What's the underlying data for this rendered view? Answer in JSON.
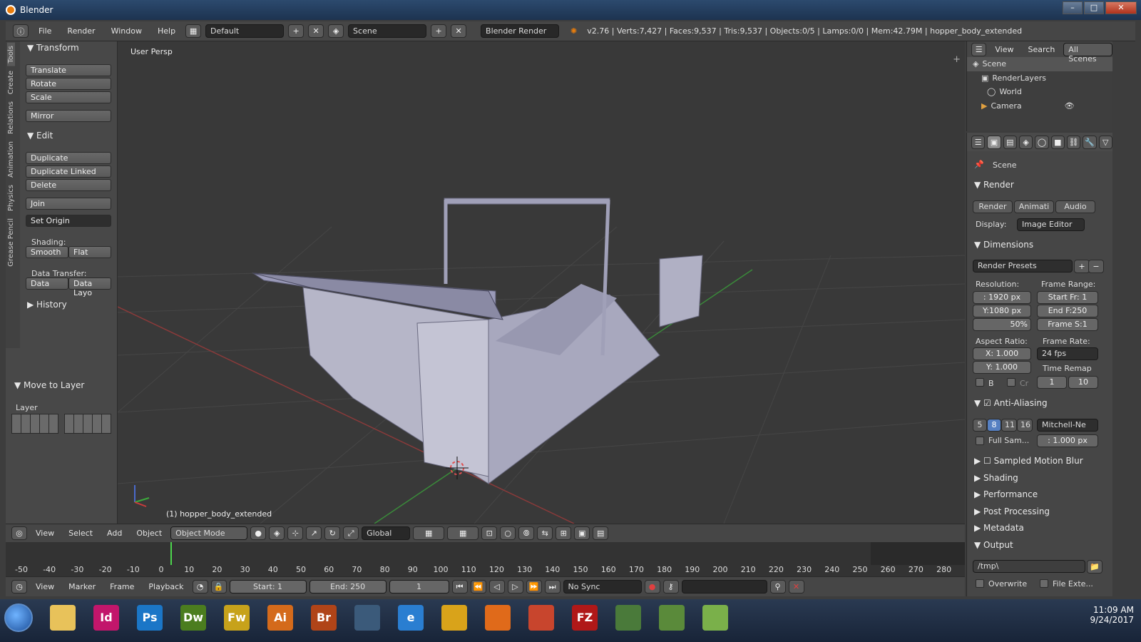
{
  "window": {
    "title": "Blender",
    "min": "–",
    "max": "□",
    "close": "✕"
  },
  "infobar": {
    "menus": [
      "File",
      "Render",
      "Window",
      "Help"
    ],
    "layout": "Default",
    "scene": "Scene",
    "engine": "Blender Render",
    "stats": "v2.76 | Verts:7,427 | Faces:9,537 | Tris:9,537 | Objects:0/5 | Lamps:0/0 | Mem:42.79M | hopper_body_extended"
  },
  "toolshelf": {
    "tabs": [
      "Tools",
      "Create",
      "Relations",
      "Animation",
      "Physics",
      "Grease Pencil"
    ],
    "transform_header": "Transform",
    "translate": "Translate",
    "rotate": "Rotate",
    "scale": "Scale",
    "mirror": "Mirror",
    "edit_header": "Edit",
    "duplicate": "Duplicate",
    "duplicate_linked": "Duplicate Linked",
    "delete": "Delete",
    "join": "Join",
    "set_origin": "Set Origin",
    "shading_label": "Shading:",
    "smooth": "Smooth",
    "flat": "Flat",
    "data_transfer_label": "Data Transfer:",
    "data": "Data",
    "data_layout": "Data Layo",
    "history_header": "History",
    "move_to_layer_header": "Move to Layer",
    "layer_label": "Layer"
  },
  "viewport": {
    "view_label": "User Persp",
    "object_label": "(1) hopper_body_extended"
  },
  "vp_header": {
    "menus": [
      "View",
      "Select",
      "Add",
      "Object"
    ],
    "mode": "Object Mode",
    "orientation": "Global"
  },
  "timeline": {
    "ticks": [
      "-50",
      "-40",
      "-30",
      "-20",
      "-10",
      "0",
      "10",
      "20",
      "30",
      "40",
      "50",
      "60",
      "70",
      "80",
      "90",
      "100",
      "110",
      "120",
      "130",
      "140",
      "150",
      "160",
      "170",
      "180",
      "190",
      "200",
      "210",
      "220",
      "230",
      "240",
      "250",
      "260",
      "270",
      "280"
    ],
    "menus": [
      "View",
      "Marker",
      "Frame",
      "Playback"
    ],
    "start": "Start:",
    "start_val": "1",
    "end": "End:",
    "end_val": "250",
    "current": "1",
    "sync": "No Sync"
  },
  "outliner": {
    "view": "View",
    "search": "Search",
    "all_scenes": "All Scenes",
    "rows": [
      "Scene",
      "RenderLayers",
      "World",
      "Camera"
    ]
  },
  "properties": {
    "context": "Scene",
    "render_header": "Render",
    "render_btn": "Render",
    "anim_btn": "Animati",
    "audio_btn": "Audio",
    "display_label": "Display:",
    "display_val": "Image Editor",
    "dimensions_header": "Dimensions",
    "presets": "Render Presets",
    "resolution_label": "Resolution:",
    "res_x": ": 1920 px",
    "res_y": "Y:1080 px",
    "res_pct": "50%",
    "frame_range_label": "Frame Range:",
    "start_fr": "Start Fr: 1",
    "end_fr": "End F:250",
    "frame_step": "Frame S:1",
    "aspect_label": "Aspect Ratio:",
    "aspect_x": "X:  1.000",
    "aspect_y": "Y:  1.000",
    "frame_rate_label": "Frame Rate:",
    "fps": "24 fps",
    "time_remap": "Time Remap",
    "b": "B",
    "cr": "Cr",
    "remap_old": "1",
    "remap_new": "10",
    "aa_header": "Anti-Aliasing",
    "aa_samples": [
      "5",
      "8",
      "11",
      "16"
    ],
    "aa_filter": "Mitchell-Ne",
    "full_sample": "Full Sam...",
    "filter_size": ": 1.000 px",
    "collapsed": [
      "Sampled Motion Blur",
      "Shading",
      "Performance",
      "Post Processing",
      "Metadata"
    ],
    "output_header": "Output",
    "output_path": "/tmp\\",
    "overwrite": "Overwrite",
    "file_ext": "File Exte..."
  },
  "taskbar": {
    "apps": [
      {
        "label": "",
        "name": "explorer"
      },
      {
        "label": "Id",
        "name": "indesign"
      },
      {
        "label": "Ps",
        "name": "photoshop"
      },
      {
        "label": "Dw",
        "name": "dreamweaver"
      },
      {
        "label": "Fw",
        "name": "fireworks"
      },
      {
        "label": "Ai",
        "name": "illustrator"
      },
      {
        "label": "Br",
        "name": "bridge"
      },
      {
        "label": "",
        "name": "blender"
      },
      {
        "label": "e",
        "name": "internet-explorer"
      },
      {
        "label": "",
        "name": "chrome"
      },
      {
        "label": "",
        "name": "firefox"
      },
      {
        "label": "",
        "name": "app-box"
      },
      {
        "label": "FZ",
        "name": "filezilla"
      },
      {
        "label": "",
        "name": "minecraft-launcher"
      },
      {
        "label": "",
        "name": "minecraft"
      },
      {
        "label": "",
        "name": "spreadsheet"
      }
    ],
    "time": "11:09 AM",
    "date": "9/24/2017"
  }
}
